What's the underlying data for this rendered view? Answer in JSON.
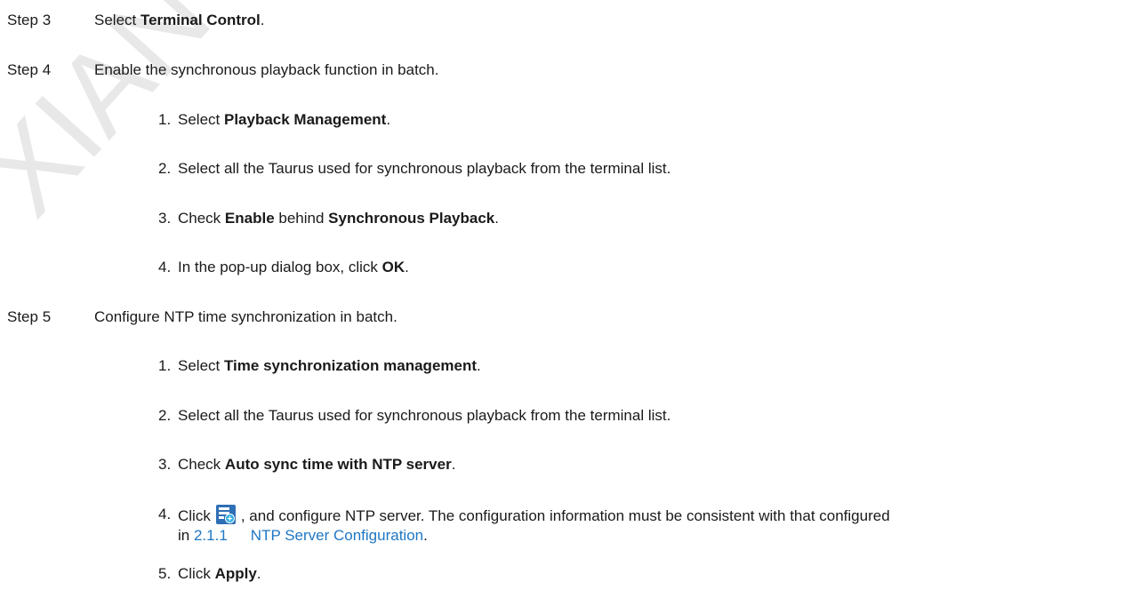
{
  "watermark": {
    "text": "XIAN NOVA",
    "color": "#e8e8e8"
  },
  "steps": [
    {
      "label": "Step 3",
      "pre": "Select ",
      "bold": "Terminal Control",
      "post": "."
    },
    {
      "label": "Step 4",
      "text": "Enable the synchronous playback function in batch."
    },
    {
      "label": "Step 5",
      "text": "Configure NTP time synchronization in batch."
    }
  ],
  "step4_items": [
    {
      "num": "1.",
      "pre": "Select ",
      "bold": "Playback Management",
      "post": "."
    },
    {
      "num": "2.",
      "text": "Select all the Taurus used for synchronous playback from the terminal list."
    },
    {
      "num": "3.",
      "pre": "Check ",
      "bold": "Enable",
      "mid": " behind ",
      "bold2": "Synchronous Playback",
      "post": "."
    },
    {
      "num": "4.",
      "pre": "In the pop-up dialog box, click ",
      "bold": "OK",
      "post": "."
    }
  ],
  "step5_items": [
    {
      "num": "1.",
      "pre": "Select ",
      "bold": "Time synchronization management",
      "post": "."
    },
    {
      "num": "2.",
      "text": "Select all the Taurus used for synchronous playback from the terminal list."
    },
    {
      "num": "3.",
      "pre": "Check ",
      "bold": "Auto sync time with NTP server",
      "post": "."
    },
    {
      "num": "4.",
      "pre": "Click",
      "post": ", and configure NTP server. The configuration information must be consistent with that configured",
      "line2_pre": "in ",
      "link_num": "2.1.1",
      "link_text": "NTP Server Configuration",
      "line2_post": "."
    },
    {
      "num": "5.",
      "pre": "Click ",
      "bold": "Apply",
      "post": "."
    }
  ],
  "icons": {
    "ntp_config": "server-config-icon"
  },
  "colors": {
    "link": "#1f77c4",
    "text": "#1a1a1a",
    "icon_bg": "#2f6fb5",
    "icon_accent": "#34b3e4"
  }
}
